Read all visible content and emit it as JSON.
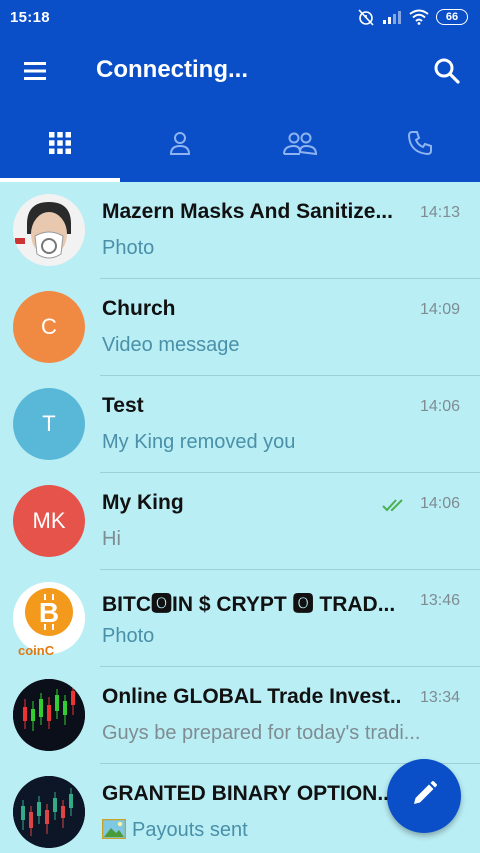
{
  "status_bar": {
    "time": "15:18",
    "battery": "66",
    "icons": [
      "alarm-off-icon",
      "signal-icon",
      "wifi-icon",
      "battery-icon"
    ]
  },
  "header": {
    "title": "Connecting...",
    "menu_icon": "hamburger-menu-icon",
    "search_icon": "search-icon"
  },
  "tabs": [
    {
      "icon": "grid-icon",
      "active": true
    },
    {
      "icon": "person-icon",
      "active": false
    },
    {
      "icon": "group-icon",
      "active": false
    },
    {
      "icon": "phone-icon",
      "active": false
    }
  ],
  "chats": [
    {
      "name": "Mazern Masks And Sanitize...",
      "time": "14:13",
      "preview": "Photo",
      "avatar_type": "photo-mask"
    },
    {
      "name": "Church",
      "time": "14:09",
      "preview": "Video message",
      "avatar_type": "initials",
      "initials": "C",
      "avatar_color": "#f08a43"
    },
    {
      "name": "Test",
      "time": "14:06",
      "preview": "My King removed you",
      "avatar_type": "initials",
      "initials": "T",
      "avatar_color": "#59b8d8"
    },
    {
      "name": "My King",
      "time": "14:06",
      "preview": "Hi",
      "avatar_type": "initials",
      "initials": "MK",
      "avatar_color": "#e5534b",
      "read": true
    },
    {
      "name": "BITC🅾IN $ CRYPT 🅾 TRAD...",
      "time": "13:46",
      "preview": "Photo",
      "avatar_type": "bitcoin",
      "avatar_text": "coinC"
    },
    {
      "name": "Online GLOBAL Trade Invest...",
      "time": "13:34",
      "preview": "Guys be prepared for today's tradi...",
      "avatar_type": "chart"
    },
    {
      "name": "GRANTED BINARY OPTION...",
      "time": "",
      "preview": "Payouts sent",
      "avatar_type": "chart2"
    }
  ],
  "fab_icon": "pencil-icon",
  "colors": {
    "primary": "#0a4fc7",
    "background": "#b9eef5",
    "preview_text": "#4a90a8",
    "read_ticks": "#4caf50"
  }
}
